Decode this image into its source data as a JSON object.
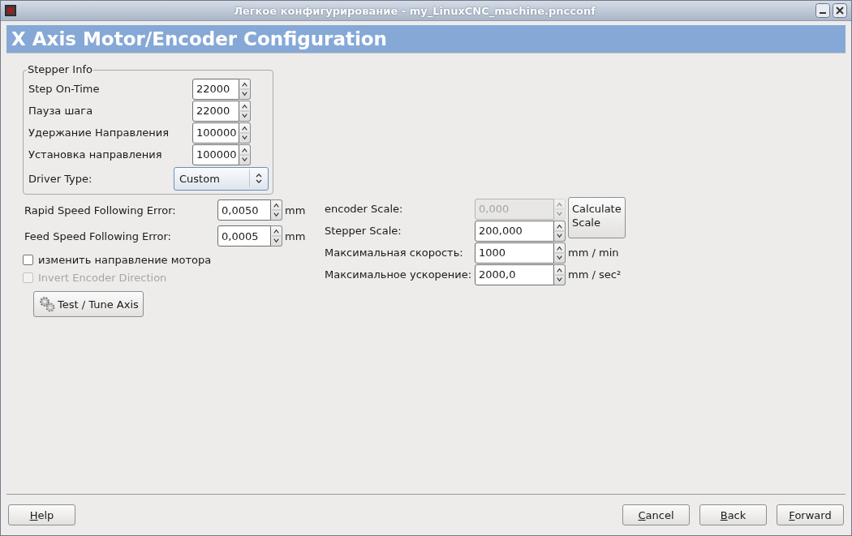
{
  "window": {
    "title": "Легкое конфигурирование - my_LinuxCNC_machine.pncconf"
  },
  "page_title": "X Axis Motor/Encoder Configuration",
  "stepper_info": {
    "title": "Stepper Info",
    "fields": [
      {
        "label": "Step On-Time",
        "value": "22000"
      },
      {
        "label": "Пауза шага",
        "value": "22000"
      },
      {
        "label": "Удержание Направления",
        "value": "100000"
      },
      {
        "label": "Установка направления",
        "value": "100000"
      }
    ],
    "driver_type": {
      "label": "Driver Type:",
      "value": "Custom"
    }
  },
  "following_errors": [
    {
      "label": "Rapid Speed Following Error:",
      "value": "0,0050",
      "unit": "mm"
    },
    {
      "label": "Feed Speed Following Error:",
      "value": "0,0005",
      "unit": "mm"
    }
  ],
  "checkboxes": [
    {
      "label": "изменить направление мотора",
      "checked": false,
      "disabled": false
    },
    {
      "label": "Invert Encoder Direction",
      "checked": false,
      "disabled": true
    }
  ],
  "test_button": {
    "label": "Test / Tune Axis"
  },
  "scale_fields": [
    {
      "label": "encoder Scale:",
      "value": "0,000",
      "disabled": true
    },
    {
      "label": "Stepper Scale:",
      "value": "200,000",
      "disabled": false
    },
    {
      "label": "Максимальная скорость:",
      "value": "1000",
      "unit": "mm / min",
      "disabled": false
    },
    {
      "label": "Максимальное ускорение:",
      "value": "2000,0",
      "unit": "mm / sec²",
      "disabled": false
    }
  ],
  "calculate_button": {
    "label": "Calculate Scale"
  },
  "buttons": [
    {
      "label": "Help"
    },
    {
      "label": "Cancel"
    },
    {
      "label": "Back"
    },
    {
      "label": "Forward"
    }
  ]
}
